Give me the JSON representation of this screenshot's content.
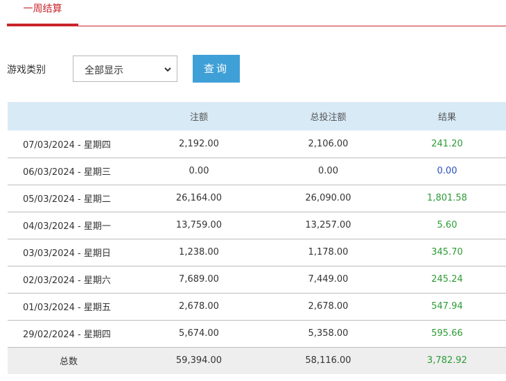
{
  "tabs": [
    {
      "label": "一周结算",
      "active": true
    }
  ],
  "filter": {
    "label": "游戏类别",
    "select_value": "全部显示",
    "button_label": "查询"
  },
  "table": {
    "headers": [
      "",
      "注额",
      "总投注额",
      "结果"
    ],
    "rows": [
      {
        "date": "07/03/2024 - 星期四",
        "bet": "2,192.00",
        "total_bet": "2,106.00",
        "result": "241.20",
        "status": "positive"
      },
      {
        "date": "06/03/2024 - 星期三",
        "bet": "0.00",
        "total_bet": "0.00",
        "result": "0.00",
        "status": "zero"
      },
      {
        "date": "05/03/2024 - 星期二",
        "bet": "26,164.00",
        "total_bet": "26,090.00",
        "result": "1,801.58",
        "status": "positive"
      },
      {
        "date": "04/03/2024 - 星期一",
        "bet": "13,759.00",
        "total_bet": "13,257.00",
        "result": "5.60",
        "status": "positive"
      },
      {
        "date": "03/03/2024 - 星期日",
        "bet": "1,238.00",
        "total_bet": "1,178.00",
        "result": "345.70",
        "status": "positive"
      },
      {
        "date": "02/03/2024 - 星期六",
        "bet": "7,689.00",
        "total_bet": "7,449.00",
        "result": "245.24",
        "status": "positive"
      },
      {
        "date": "01/03/2024 - 星期五",
        "bet": "2,678.00",
        "total_bet": "2,678.00",
        "result": "547.94",
        "status": "positive"
      },
      {
        "date": "29/02/2024 - 星期四",
        "bet": "5,674.00",
        "total_bet": "5,358.00",
        "result": "595.66",
        "status": "positive"
      }
    ],
    "total": {
      "label": "总数",
      "bet": "59,394.00",
      "total_bet": "58,116.00",
      "result": "3,782.92",
      "status": "positive"
    }
  },
  "colors": {
    "accent": "#c9242b",
    "button": "#3fa0d7",
    "header_bg": "#d8eaf6",
    "positive": "#2c9b36",
    "zero": "#2a4fbf"
  }
}
